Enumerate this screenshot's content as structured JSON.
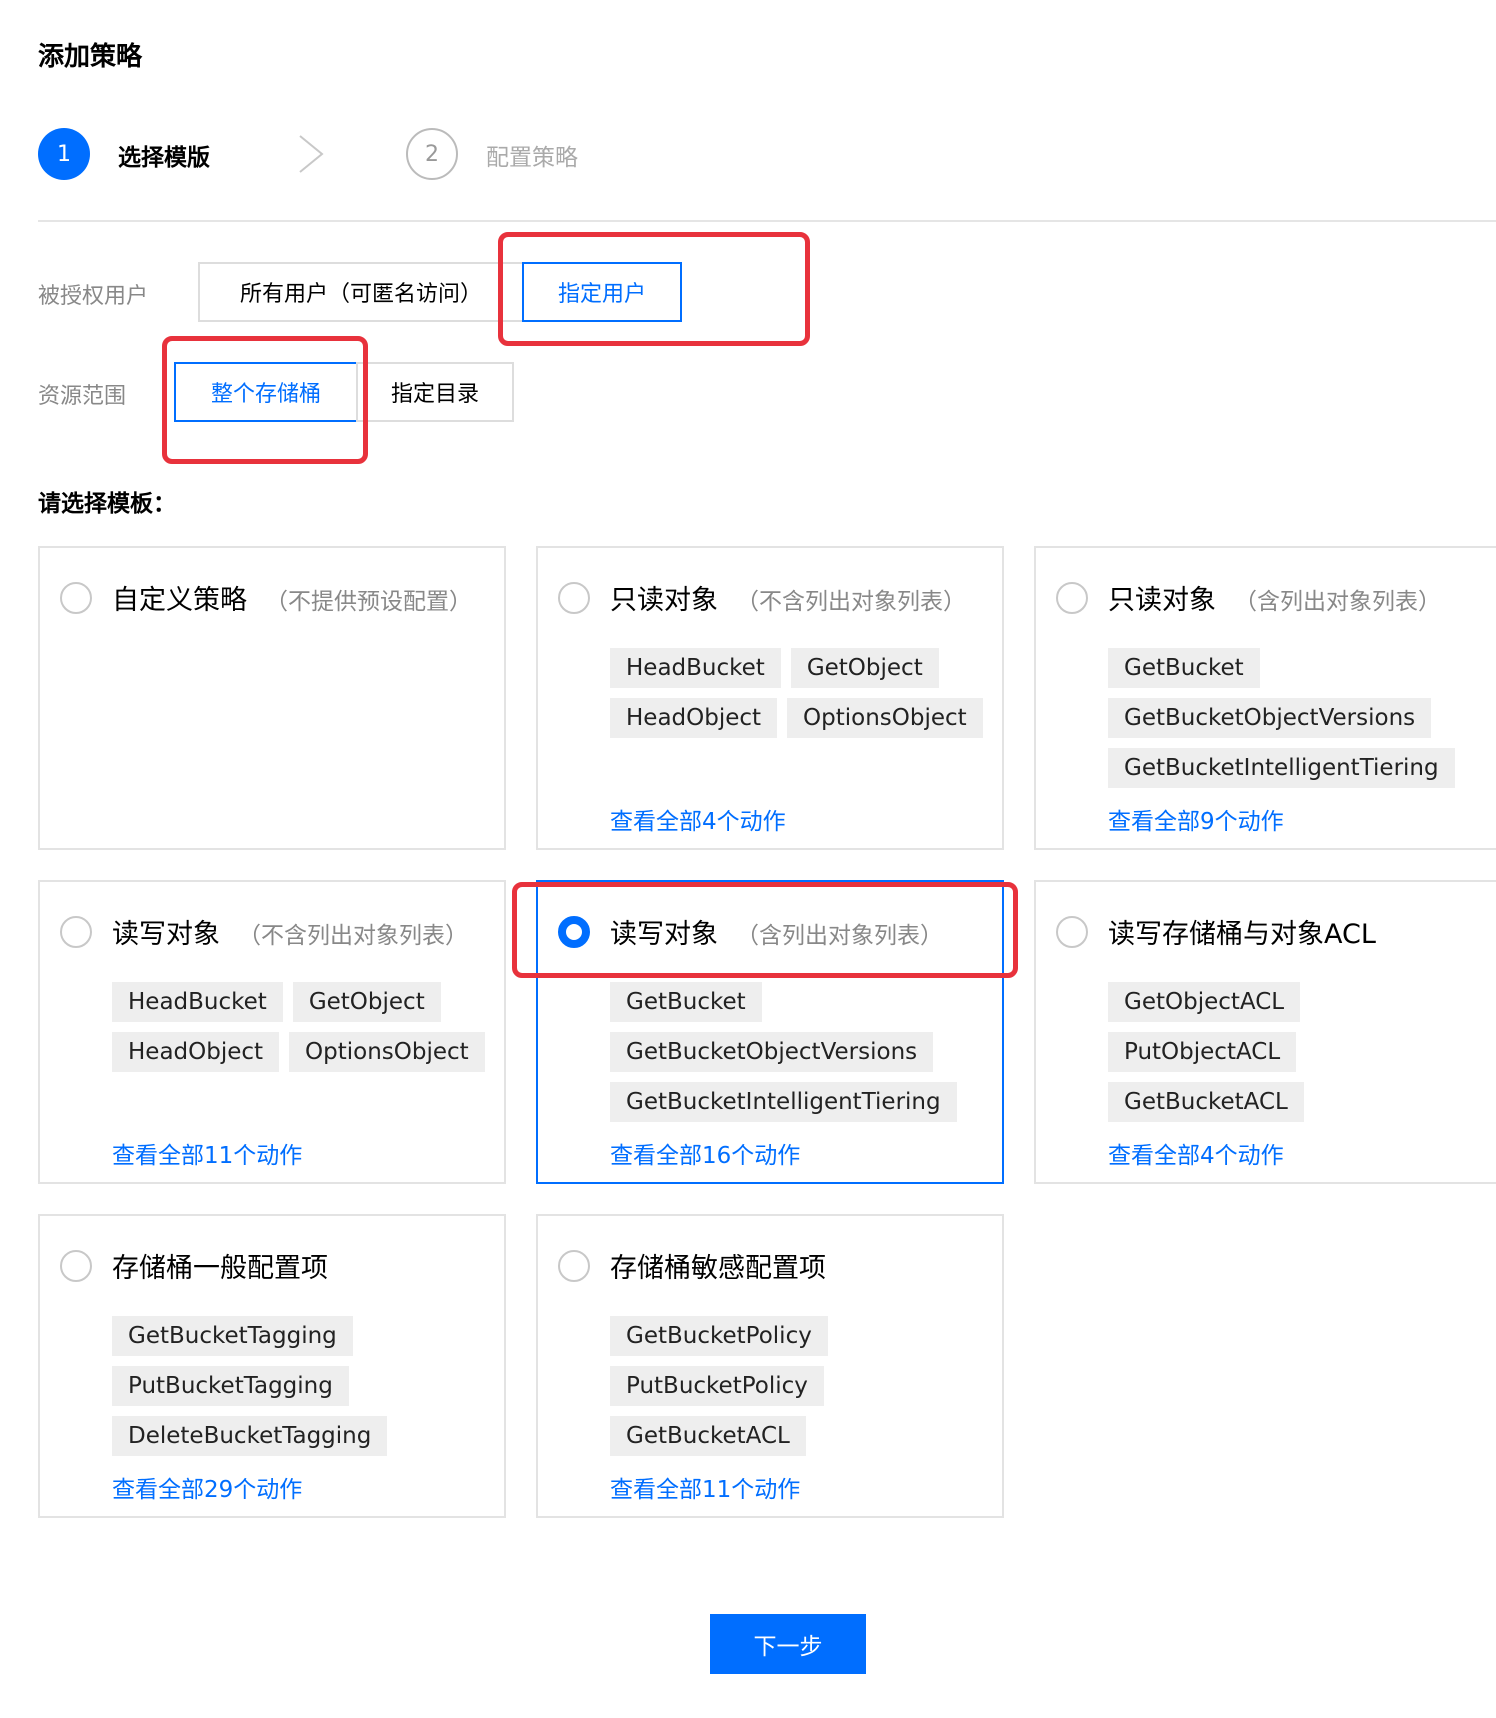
{
  "page": {
    "title": "添加策略"
  },
  "steps": [
    {
      "num": "1",
      "label": "选择模版"
    },
    {
      "num": "2",
      "label": "配置策略"
    }
  ],
  "authorized_user": {
    "label": "被授权用户",
    "options": [
      "所有用户（可匿名访问）",
      "指定用户"
    ],
    "selected": "指定用户"
  },
  "resource_scope": {
    "label": "资源范围",
    "options": [
      "整个存储桶",
      "指定目录"
    ],
    "selected": "整个存储桶"
  },
  "template_section": {
    "title": "请选择模板："
  },
  "templates": [
    {
      "title": "自定义策略",
      "subtitle": "（不提供预设配置）",
      "tags": [],
      "more": "",
      "checked": false
    },
    {
      "title": "只读对象",
      "subtitle": "（不含列出对象列表）",
      "tags": [
        "HeadBucket",
        "GetObject",
        "HeadObject",
        "OptionsObject"
      ],
      "more": "查看全部4个动作",
      "checked": false
    },
    {
      "title": "只读对象",
      "subtitle": "（含列出对象列表）",
      "tags": [
        "GetBucket",
        "GetBucketObjectVersions",
        "GetBucketIntelligentTiering"
      ],
      "more": "查看全部9个动作",
      "checked": false
    },
    {
      "title": "读写对象",
      "subtitle": "（不含列出对象列表）",
      "tags": [
        "HeadBucket",
        "GetObject",
        "HeadObject",
        "OptionsObject"
      ],
      "more": "查看全部11个动作",
      "checked": false
    },
    {
      "title": "读写对象",
      "subtitle": "（含列出对象列表）",
      "tags": [
        "GetBucket",
        "GetBucketObjectVersions",
        "GetBucketIntelligentTiering"
      ],
      "more": "查看全部16个动作",
      "checked": true
    },
    {
      "title": "读写存储桶与对象ACL",
      "subtitle": "",
      "tags": [
        "GetObjectACL",
        "PutObjectACL",
        "GetBucketACL"
      ],
      "more": "查看全部4个动作",
      "checked": false
    },
    {
      "title": "存储桶一般配置项",
      "subtitle": "",
      "tags": [
        "GetBucketTagging",
        "PutBucketTagging",
        "DeleteBucketTagging"
      ],
      "more": "查看全部29个动作",
      "checked": false
    },
    {
      "title": "存储桶敏感配置项",
      "subtitle": "",
      "tags": [
        "GetBucketPolicy",
        "PutBucketPolicy",
        "GetBucketACL"
      ],
      "more": "查看全部11个动作",
      "checked": false
    }
  ],
  "actions": {
    "next_label": "下一步"
  },
  "colors": {
    "primary": "#006eff",
    "annotation": "#e8323c",
    "tag_bg": "#eeeeee"
  }
}
